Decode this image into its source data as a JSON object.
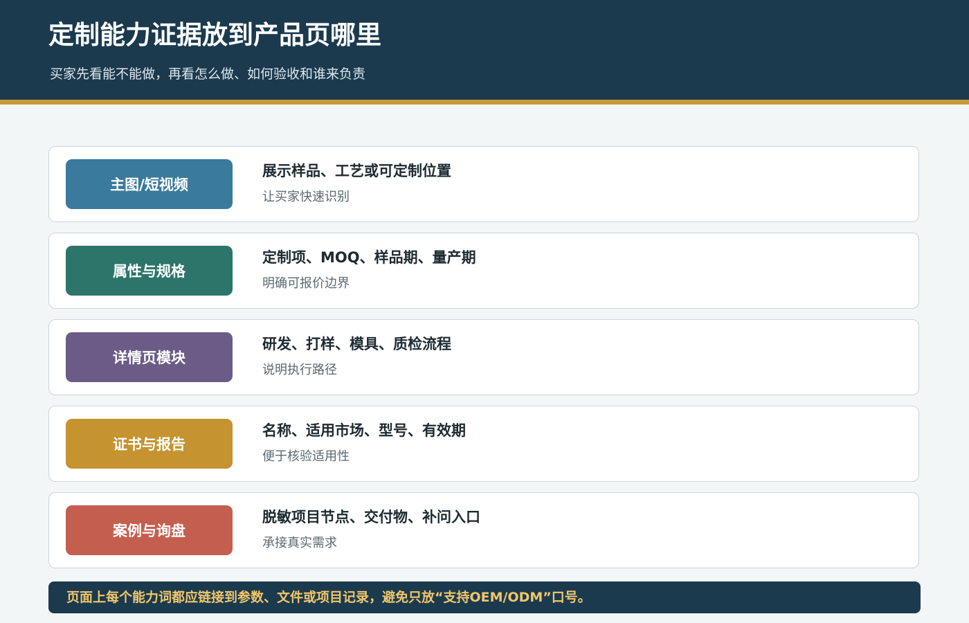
{
  "header": {
    "title": "定制能力证据放到产品页哪里",
    "subtitle": "买家先看能不能做，再看怎么做、如何验收和谁来负责"
  },
  "cards": [
    {
      "tag": "主图/短视频",
      "color": "#3a7a9c",
      "title": "展示样品、工艺或可定制位置",
      "desc": "让买家快速识别"
    },
    {
      "tag": "属性与规格",
      "color": "#2d756a",
      "title": "定制项、MOQ、样品期、量产期",
      "desc": "明确可报价边界"
    },
    {
      "tag": "详情页模块",
      "color": "#6b5b87",
      "title": "研发、打样、模具、质检流程",
      "desc": "说明执行路径"
    },
    {
      "tag": "证书与报告",
      "color": "#c59330",
      "title": "名称、适用市场、型号、有效期",
      "desc": "便于核验适用性"
    },
    {
      "tag": "案例与询盘",
      "color": "#c45f50",
      "title": "脱敏项目节点、交付物、补问入口",
      "desc": "承接真实需求"
    }
  ],
  "footer": {
    "text": "页面上每个能力词都应链接到参数、文件或项目记录，避免只放“支持OEM/ODM”口号。"
  },
  "colors": {
    "header_bg": "#1b3a4e",
    "accent_rule": "#c99a3a",
    "footer_text": "#f1c76a"
  }
}
